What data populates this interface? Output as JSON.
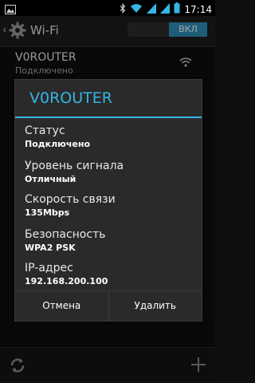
{
  "status_bar": {
    "time": "17:14"
  },
  "action_bar": {
    "title": "Wi-Fi",
    "toggle_label": "ВКЛ"
  },
  "network": {
    "name": "V0ROUTER",
    "status": "Подключено"
  },
  "dialog": {
    "title": "V0ROUTER",
    "fields": [
      {
        "label": "Статус",
        "value": "Подключено"
      },
      {
        "label": "Уровень сигнала",
        "value": "Отличный"
      },
      {
        "label": "Скорость связи",
        "value": "135Mbps"
      },
      {
        "label": "Безопасность",
        "value": "WPA2 PSK"
      },
      {
        "label": "IP-адрес",
        "value": "192.168.200.100"
      }
    ],
    "cancel_label": "Отмена",
    "delete_label": "Удалить"
  },
  "colors": {
    "accent": "#33b5e5",
    "toggle_on": "#2f8fb8"
  }
}
